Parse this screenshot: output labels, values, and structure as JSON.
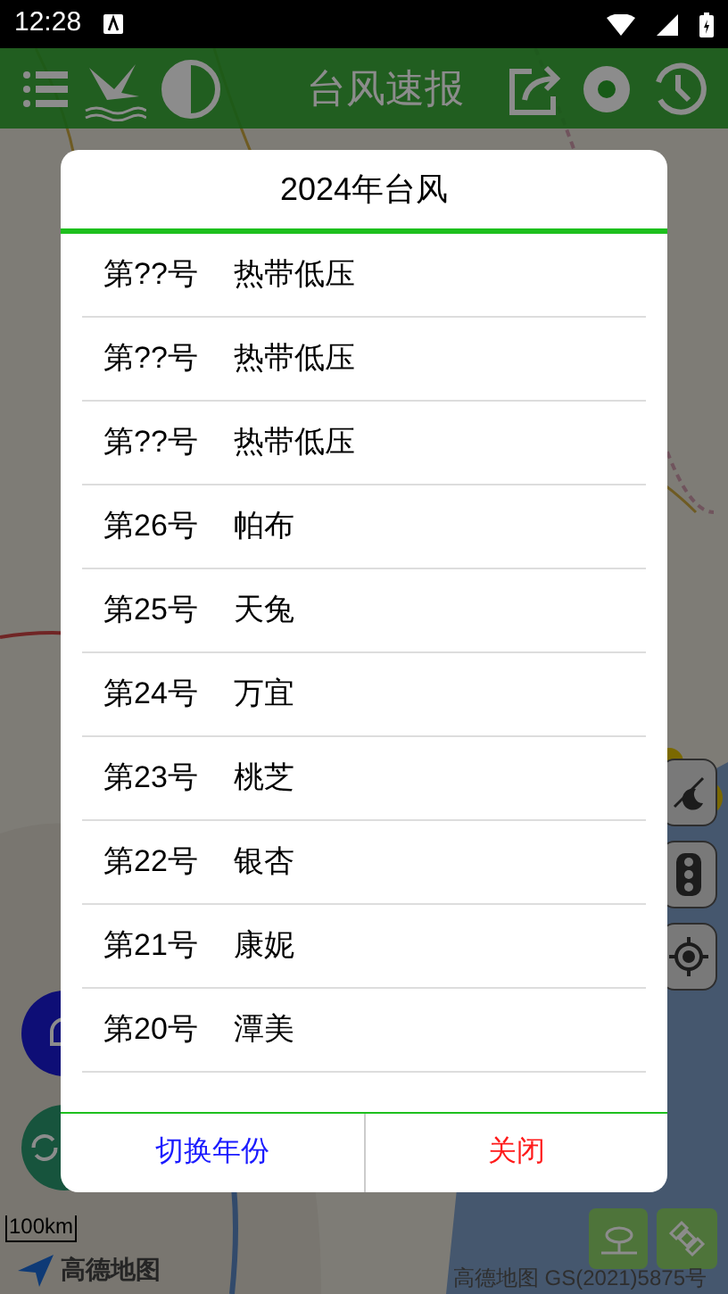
{
  "status_bar": {
    "time": "12:28"
  },
  "app_bar": {
    "title": "台风速报"
  },
  "map": {
    "scale": "100km",
    "logo": "高德地图",
    "copyright": "高德地图 GS(2021)5875号"
  },
  "dialog": {
    "title": "2024年台风",
    "typhoons": [
      {
        "number": "第??号",
        "name": "热带低压"
      },
      {
        "number": "第??号",
        "name": "热带低压"
      },
      {
        "number": "第??号",
        "name": "热带低压"
      },
      {
        "number": "第26号",
        "name": "帕布"
      },
      {
        "number": "第25号",
        "name": "天兔"
      },
      {
        "number": "第24号",
        "name": "万宜"
      },
      {
        "number": "第23号",
        "name": "桃芝"
      },
      {
        "number": "第22号",
        "name": "银杏"
      },
      {
        "number": "第21号",
        "name": "康妮"
      },
      {
        "number": "第20号",
        "name": "潭美"
      }
    ],
    "buttons": [
      {
        "label": "切换年份",
        "kind": "switch"
      },
      {
        "label": "关闭",
        "kind": "close"
      }
    ]
  }
}
